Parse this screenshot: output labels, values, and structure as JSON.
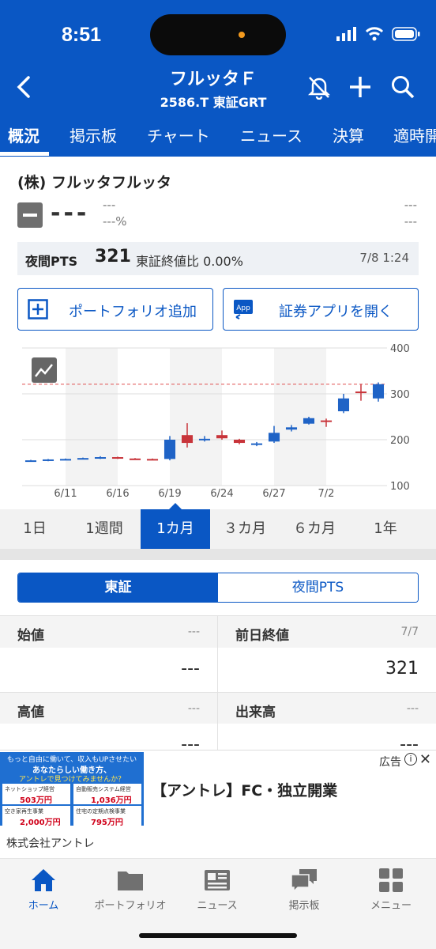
{
  "status_bar": {
    "time": "8:51"
  },
  "header": {
    "title": "フルッタＦ",
    "subtitle": "2586.T 東証GRT"
  },
  "tabs": [
    "概況",
    "掲示板",
    "チャート",
    "ニュース",
    "決算",
    "適時開"
  ],
  "stock": {
    "name": "(株) フルッタフルッタ",
    "price": "---",
    "change": "---",
    "change_pct": "---%",
    "right_1": "---",
    "right_2": "---"
  },
  "pts": {
    "label": "夜間PTS",
    "value": "321",
    "compare": "東証終値比 0.00%",
    "datetime": "7/8 1:24"
  },
  "buttons": {
    "portfolio_add": "ポートフォリオ追加",
    "open_app": "証券アプリを開く"
  },
  "chart_data": {
    "type": "candlestick",
    "x_tick_labels": [
      "6/11",
      "6/16",
      "6/19",
      "6/24",
      "6/27",
      "7/2"
    ],
    "y_tick_labels": [
      "400",
      "300",
      "200",
      "100"
    ],
    "ylim": [
      100,
      400
    ],
    "reference_line": 321,
    "candles": [
      {
        "open": 155,
        "close": 155,
        "high": 156,
        "low": 153
      },
      {
        "open": 155,
        "close": 157,
        "high": 158,
        "low": 153
      },
      {
        "open": 157,
        "close": 158,
        "high": 159,
        "low": 156
      },
      {
        "open": 158,
        "close": 160,
        "high": 161,
        "low": 157
      },
      {
        "open": 160,
        "close": 162,
        "high": 164,
        "low": 158
      },
      {
        "open": 162,
        "close": 159,
        "high": 163,
        "low": 158
      },
      {
        "open": 159,
        "close": 158,
        "high": 160,
        "low": 156
      },
      {
        "open": 158,
        "close": 157,
        "high": 159,
        "low": 156
      },
      {
        "open": 158,
        "close": 200,
        "high": 208,
        "low": 155
      },
      {
        "open": 210,
        "close": 193,
        "high": 236,
        "low": 183
      },
      {
        "open": 200,
        "close": 202,
        "high": 208,
        "low": 196
      },
      {
        "open": 210,
        "close": 203,
        "high": 220,
        "low": 200
      },
      {
        "open": 200,
        "close": 193,
        "high": 202,
        "low": 190
      },
      {
        "open": 190,
        "close": 192,
        "high": 195,
        "low": 186
      },
      {
        "open": 196,
        "close": 215,
        "high": 230,
        "low": 193
      },
      {
        "open": 222,
        "close": 227,
        "high": 232,
        "low": 218
      },
      {
        "open": 235,
        "close": 247,
        "high": 250,
        "low": 233
      },
      {
        "open": 242,
        "close": 239,
        "high": 246,
        "low": 228
      },
      {
        "open": 262,
        "close": 290,
        "high": 300,
        "low": 258
      },
      {
        "open": 305,
        "close": 303,
        "high": 321,
        "low": 285
      },
      {
        "open": 290,
        "close": 321,
        "high": 325,
        "low": 283
      }
    ],
    "colors": {
      "up": "#1f63c6",
      "down": "#c8343a"
    }
  },
  "periods": [
    "1日",
    "1週間",
    "1カ月",
    "３カ月",
    "６カ月",
    "1年"
  ],
  "market_toggle": {
    "tse": "東証",
    "pts": "夜間PTS"
  },
  "quote": {
    "open_label": "始値",
    "open_date": "---",
    "open_value": "---",
    "prev_close_label": "前日終値",
    "prev_close_date": "7/7",
    "prev_close_value": "321",
    "high_label": "高値",
    "high_date": "---",
    "high_value": "---",
    "volume_label": "出来高",
    "volume_date": "---",
    "volume_value": "---"
  },
  "ad": {
    "img_line1": "もっと自由に働いて、収入もUPさせたい",
    "img_line2": "あなたらしい働き方、",
    "img_line3": "アントレで見つけてみませんか？",
    "tiles": [
      {
        "title": "ネットショップ経営",
        "value": "503万円"
      },
      {
        "title": "自動販売システム経営",
        "value": "1,036万円"
      },
      {
        "title": "空き家再生事業",
        "value": "2,000万円"
      },
      {
        "title": "住宅の定期点検事業",
        "value": "795万円"
      }
    ],
    "headline": "【アントレ】FC・独立開業",
    "label": "広告",
    "sponsor": "株式会社アントレ"
  },
  "bottom_nav": [
    "ホーム",
    "ポートフォリオ",
    "ニュース",
    "掲示板",
    "メニュー"
  ],
  "colors": {
    "brand": "#0a57c4"
  }
}
